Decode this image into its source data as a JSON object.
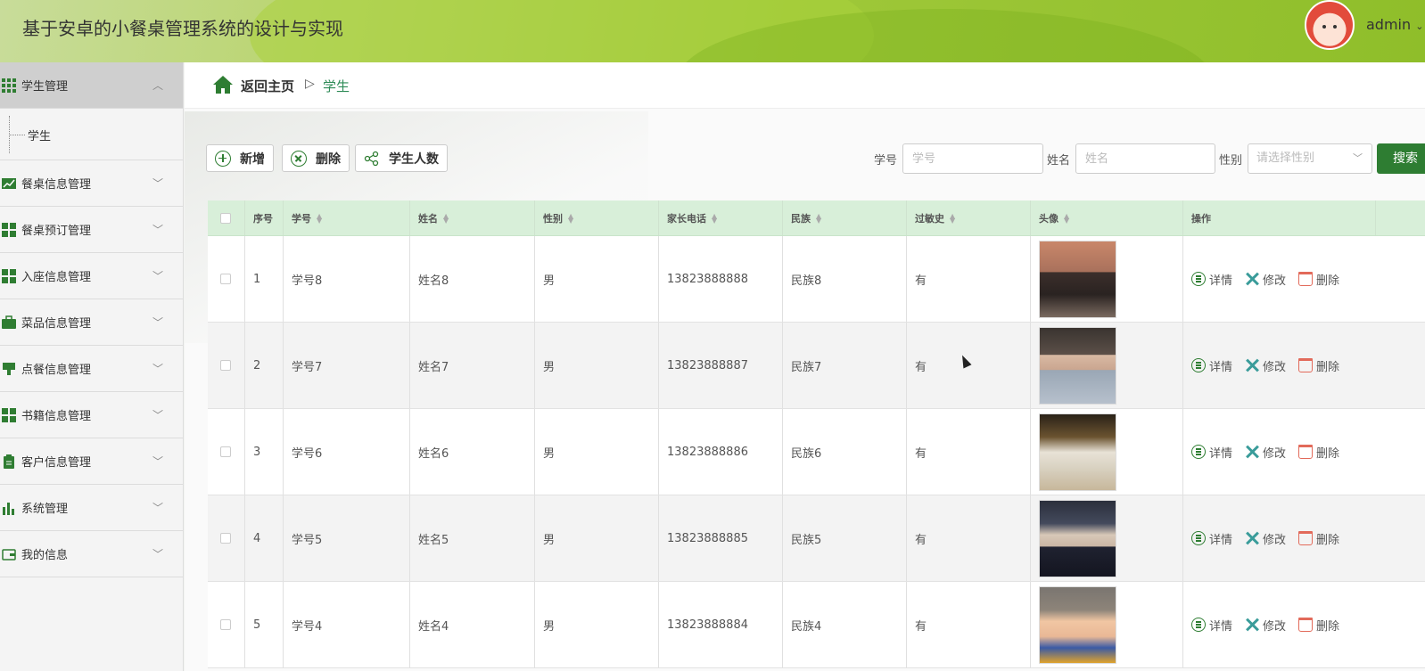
{
  "header": {
    "title": "基于安卓的小餐桌管理系统的设计与实现",
    "user": "admin",
    "brand_color": "#9fc839"
  },
  "sidebar": {
    "items": [
      {
        "label": "学生管理",
        "icon": "grid-icon",
        "expanded": true,
        "children": [
          "学生"
        ]
      },
      {
        "label": "餐桌信息管理",
        "icon": "chart-line-icon"
      },
      {
        "label": "餐桌预订管理",
        "icon": "apps-icon"
      },
      {
        "label": "入座信息管理",
        "icon": "apps-icon"
      },
      {
        "label": "菜品信息管理",
        "icon": "briefcase-icon"
      },
      {
        "label": "点餐信息管理",
        "icon": "pin-icon"
      },
      {
        "label": "书籍信息管理",
        "icon": "apps-icon"
      },
      {
        "label": "客户信息管理",
        "icon": "clipboard-icon"
      },
      {
        "label": "系统管理",
        "icon": "bar-chart-icon"
      },
      {
        "label": "我的信息",
        "icon": "wallet-icon"
      }
    ]
  },
  "breadcrumb": {
    "home": "返回主页",
    "separator": "▷",
    "current": "学生"
  },
  "toolbar": {
    "add": "新增",
    "delete": "删除",
    "count": "学生人数"
  },
  "search": {
    "id_label": "学号",
    "id_placeholder": "学号",
    "name_label": "姓名",
    "name_placeholder": "姓名",
    "gender_label": "性别",
    "gender_placeholder": "请选择性别",
    "button": "搜索"
  },
  "table": {
    "headers": [
      "序号",
      "学号",
      "姓名",
      "性别",
      "家长电话",
      "民族",
      "过敏史",
      "头像",
      "操作"
    ],
    "rows": [
      {
        "no": "1",
        "id": "学号8",
        "name": "姓名8",
        "gender": "男",
        "phone": "13823888888",
        "nation": "民族8",
        "allergy": "有"
      },
      {
        "no": "2",
        "id": "学号7",
        "name": "姓名7",
        "gender": "男",
        "phone": "13823888887",
        "nation": "民族7",
        "allergy": "有"
      },
      {
        "no": "3",
        "id": "学号6",
        "name": "姓名6",
        "gender": "男",
        "phone": "13823888886",
        "nation": "民族6",
        "allergy": "有"
      },
      {
        "no": "4",
        "id": "学号5",
        "name": "姓名5",
        "gender": "男",
        "phone": "13823888885",
        "nation": "民族5",
        "allergy": "有"
      },
      {
        "no": "5",
        "id": "学号4",
        "name": "姓名4",
        "gender": "男",
        "phone": "13823888884",
        "nation": "民族4",
        "allergy": "有"
      }
    ],
    "actions": {
      "detail": "详情",
      "edit": "修改",
      "delete": "删除"
    }
  }
}
